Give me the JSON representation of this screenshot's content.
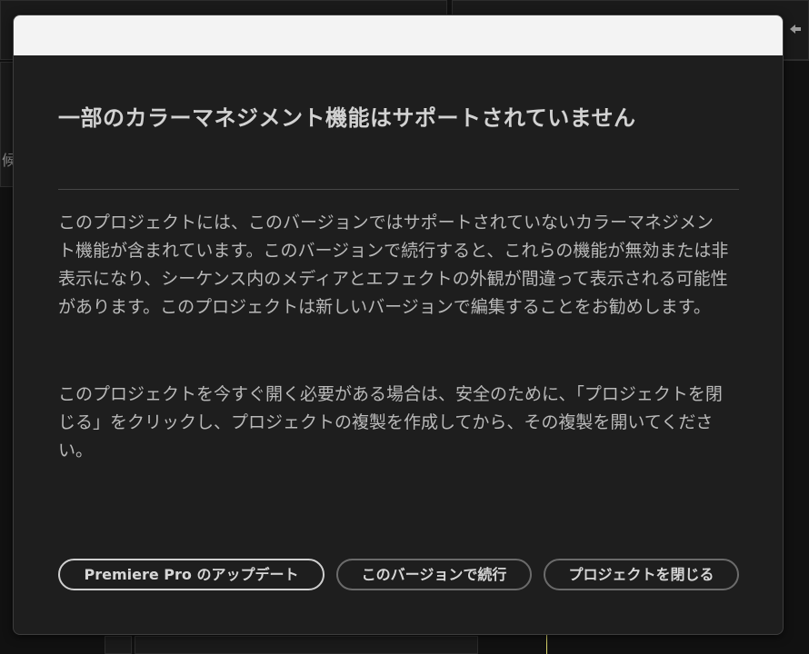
{
  "background": {
    "glyph": "候"
  },
  "dialog": {
    "heading": "一部のカラーマネジメント機能はサポートされていません",
    "paragraphs": [
      "このプロジェクトには、このバージョンではサポートされていないカラーマネジメント機能が含まれています。このバージョンで続行すると、これらの機能が無効または非表示になり、シーケンス内のメディアとエフェクトの外観が間違って表示される可能性があります。このプロジェクトは新しいバージョンで編集することをお勧めします。",
      "このプロジェクトを今すぐ開く必要がある場合は、安全のために、「プロジェクトを閉じる」をクリックし、プロジェクトの複製を作成してから、その複製を開いてください。"
    ],
    "buttons": {
      "update": "Premiere Pro のアップデート",
      "continue": "このバージョンで続行",
      "close": "プロジェクトを閉じる"
    }
  },
  "colors": {
    "dialog_bg": "#1e1e1e",
    "title_bar": "#f3f3f3",
    "heading": "#d2d2d2",
    "body_text": "#b9b9b9",
    "primary_border": "#cfcfcf",
    "secondary_border": "#6b6b6b",
    "playhead": "#d8d36a"
  }
}
